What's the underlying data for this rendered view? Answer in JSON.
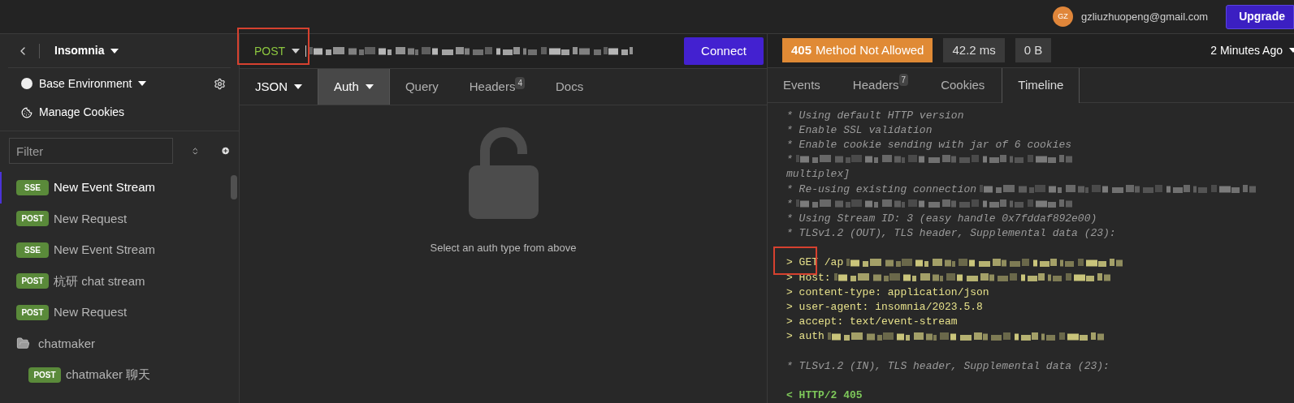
{
  "top_bar": {
    "avatar_initials": "GZ",
    "email": "gzliuzhuopeng@gmail.com",
    "upgrade_button": "Upgrade"
  },
  "sidebar": {
    "project": "Insomnia",
    "environment": "Base Environment",
    "cookies": "Manage Cookies",
    "filter": {
      "placeholder": "Filter"
    },
    "items": [
      {
        "kind": "request",
        "method": "SSE",
        "name": "New Event Stream",
        "selected": true
      },
      {
        "kind": "request",
        "method": "POST",
        "name": "New Request",
        "selected": false
      },
      {
        "kind": "request",
        "method": "SSE",
        "name": "New Event Stream",
        "selected": false
      },
      {
        "kind": "request",
        "method": "POST",
        "name": "杭研 chat stream",
        "selected": false
      },
      {
        "kind": "request",
        "method": "POST",
        "name": "New Request",
        "selected": false
      },
      {
        "kind": "folder",
        "name": "chatmaker",
        "expanded": true,
        "children": [
          {
            "kind": "request",
            "method": "POST",
            "name": "chatmaker 聊天",
            "selected": false
          }
        ]
      }
    ]
  },
  "request": {
    "method": "POST",
    "connect_button": "Connect",
    "tabs": [
      {
        "label": "JSON",
        "dropdown": true,
        "selected": false
      },
      {
        "label": "Auth",
        "dropdown": true,
        "selected": true
      },
      {
        "label": "Query",
        "dropdown": false,
        "selected": false
      },
      {
        "label": "Headers",
        "badge": "4",
        "dropdown": false,
        "selected": false
      },
      {
        "label": "Docs",
        "dropdown": false,
        "selected": false
      }
    ],
    "empty_message": "Select an auth type from above"
  },
  "response": {
    "status_code": "405",
    "status_text": "Method Not Allowed",
    "time": "42.2 ms",
    "size": "0 B",
    "history": "2 Minutes Ago",
    "tabs": [
      {
        "label": "Events",
        "selected": false
      },
      {
        "label": "Headers",
        "badge": "7",
        "selected": false
      },
      {
        "label": "Cookies",
        "selected": false
      },
      {
        "label": "Timeline",
        "selected": true
      }
    ],
    "timeline": [
      {
        "kind": "info",
        "text": "* Using default HTTP version"
      },
      {
        "kind": "info",
        "text": "* Enable SSL validation"
      },
      {
        "kind": "info",
        "text": "* Enable cookie sending with jar of 6 cookies"
      },
      {
        "kind": "info",
        "text": "*",
        "redacted": true
      },
      {
        "kind": "info",
        "text": "multiplex]"
      },
      {
        "kind": "info",
        "text": "* Re-using existing connection",
        "redacted": true
      },
      {
        "kind": "info",
        "text": "*",
        "redacted": true
      },
      {
        "kind": "info",
        "text": "* Using Stream ID: 3 (easy handle 0x7fddaf892e00)"
      },
      {
        "kind": "info",
        "text": "* TLSv1.2 (OUT), TLS header, Supplemental data (23):"
      },
      {
        "kind": "blank"
      },
      {
        "kind": "out",
        "text": "> GET /ap",
        "redacted": true
      },
      {
        "kind": "out",
        "text": "> Host:",
        "redacted": true
      },
      {
        "kind": "out",
        "text": "> content-type: application/json"
      },
      {
        "kind": "out",
        "text": "> user-agent: insomnia/2023.5.8"
      },
      {
        "kind": "out",
        "text": "> accept: text/event-stream"
      },
      {
        "kind": "out",
        "text": "> auth",
        "redacted": true
      },
      {
        "kind": "blank"
      },
      {
        "kind": "info",
        "text": "* TLSv1.2 (IN), TLS header, Supplemental data (23):"
      },
      {
        "kind": "blank"
      },
      {
        "kind": "in",
        "text": "< HTTP/2 405"
      }
    ]
  }
}
